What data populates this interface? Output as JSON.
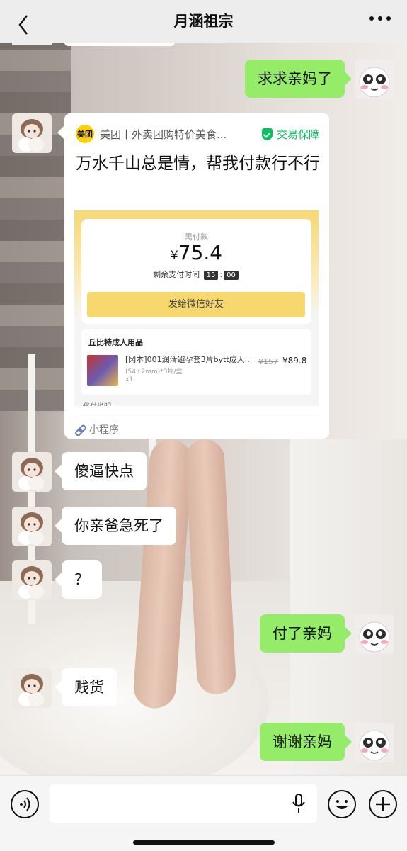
{
  "header": {
    "title": "月涵祖宗"
  },
  "messages": [
    {
      "side": "right",
      "text": "求求亲妈了"
    },
    {
      "side": "left",
      "text": "傻逼快点"
    },
    {
      "side": "left",
      "text": "你亲爸急死了"
    },
    {
      "side": "left",
      "text": "？"
    },
    {
      "side": "right",
      "text": "付了亲妈"
    },
    {
      "side": "left",
      "text": "贱货"
    },
    {
      "side": "right",
      "text": "谢谢亲妈"
    }
  ],
  "card": {
    "logo_text": "美团",
    "source": "美团丨外卖团购特价美食...",
    "guarantee": "交易保障",
    "description": "万水千山总是情，帮我付款行不行",
    "payment": {
      "label": "需付款",
      "currency": "¥",
      "amount": "75.4",
      "timer_label": "剩余支付时间",
      "timer_min": "15",
      "timer_sep": ":",
      "timer_sec": "00",
      "send_button": "发给微信好友"
    },
    "product": {
      "shop": "丘比特成人用品",
      "name": "[冈本]001润滑避孕套3片bytt成人...",
      "spec": "(54±2mm)*3片/盒",
      "qty": "x1",
      "old_price": "¥157",
      "price": "¥89.8"
    },
    "more_text": "代付说明",
    "mini_program": "小程序"
  }
}
